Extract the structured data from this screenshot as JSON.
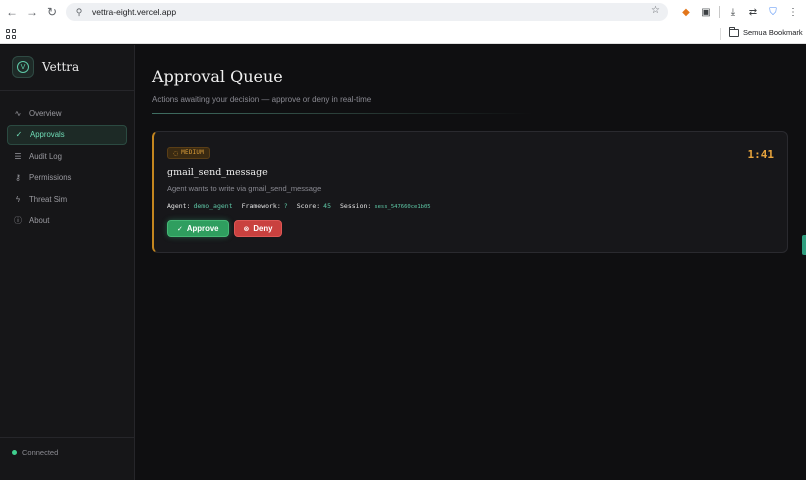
{
  "browser": {
    "url": "vettra-eight.vercel.app",
    "back_icon": "←",
    "forward_icon": "→",
    "reload_icon": "↻",
    "tune_icon": "⚲",
    "star_icon": "☆",
    "ext_icons": [
      "✕",
      "▣",
      "⤓",
      "⇄",
      "⛉",
      "⋮"
    ],
    "bookmark_folder": "Semua Bookmark"
  },
  "app": {
    "brand": "Vettra",
    "logo_glyph": "V",
    "nav": [
      {
        "label": "Overview",
        "icon": "∿",
        "active": false
      },
      {
        "label": "Approvals",
        "icon": "✓",
        "active": true
      },
      {
        "label": "Audit Log",
        "icon": "☰",
        "active": false
      },
      {
        "label": "Permissions",
        "icon": "⚷",
        "active": false
      },
      {
        "label": "Threat Sim",
        "icon": "ϟ",
        "active": false
      },
      {
        "label": "About",
        "icon": "ⓘ",
        "active": false
      }
    ],
    "connection_status": "Connected",
    "status_color": "#3fcf8e"
  },
  "page": {
    "title": "Approval Queue",
    "subtitle": "Actions awaiting your decision — approve or deny in real-time"
  },
  "approval": {
    "risk_level": "MEDIUM",
    "risk_color": "#e0a13a",
    "risk_icon": "◌",
    "timer": "1:41",
    "tool": "gmail_send_message",
    "description": "Agent wants to write via gmail_send_message",
    "agent_label": "Agent:",
    "agent": "demo_agent",
    "framework_label": "Framework:",
    "framework": "?",
    "score_label": "Score:",
    "score": "45",
    "session_label": "Session:",
    "session": "sess_547660ce1b05",
    "approve_label": "Approve",
    "approve_icon": "✓",
    "deny_label": "Deny",
    "deny_icon": "⊗"
  }
}
